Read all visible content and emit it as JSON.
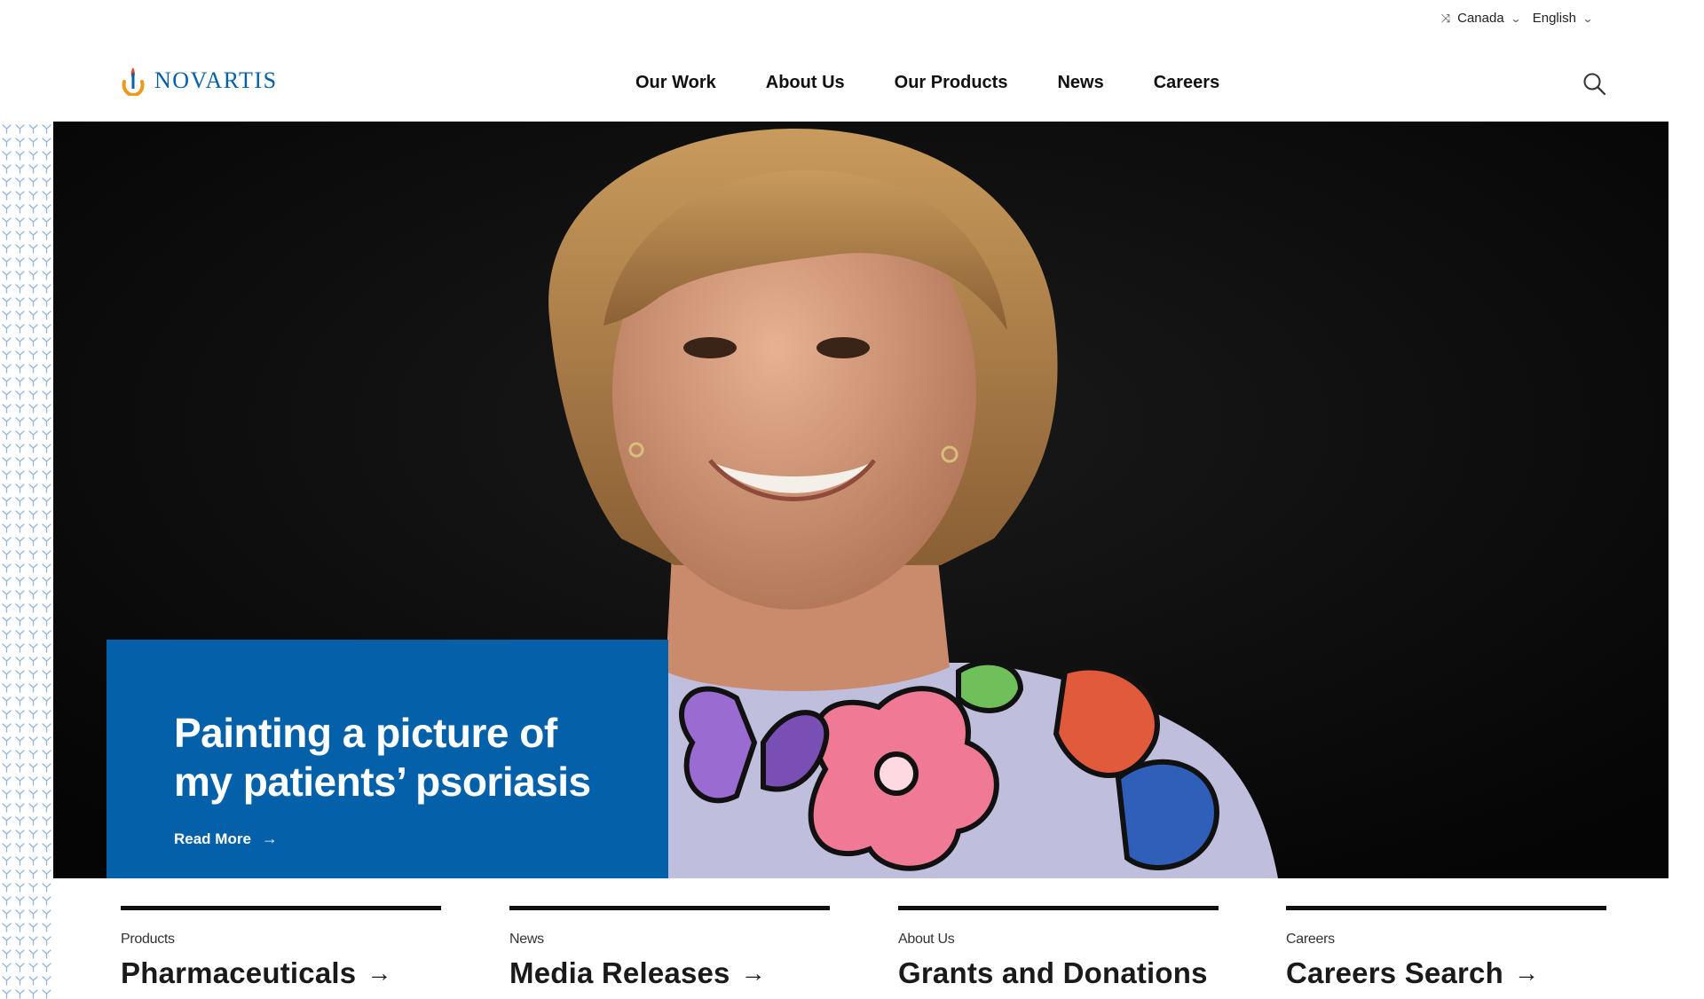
{
  "utility": {
    "country": "Canada",
    "language": "English",
    "country_icon": "switch-arrows-icon",
    "chevron_icon": "chevron-down-icon"
  },
  "header": {
    "logo_text": "NOVARTIS",
    "nav": [
      "Our Work",
      "About Us",
      "Our Products",
      "News",
      "Careers"
    ],
    "search_icon": "search-icon"
  },
  "hero": {
    "title_line1": "Painting a picture of",
    "title_line2": "my patients’ psoriasis",
    "link_label": "Read More",
    "link_arrow": "→",
    "slide_count": 4,
    "active_slide": 3
  },
  "cards": [
    {
      "category": "Products",
      "title": "Pharmaceuticals",
      "arrow": "→"
    },
    {
      "category": "News",
      "title": "Media Releases",
      "arrow": "→"
    },
    {
      "category": "About Us",
      "title": "Grants and Donations",
      "arrow": ""
    },
    {
      "category": "Careers",
      "title": "Careers Search",
      "arrow": "→"
    }
  ],
  "colors": {
    "brand_blue": "#0460a9",
    "logo_orange": "#ec9a1e",
    "logo_red": "#e74a21",
    "text_dark": "#111111",
    "pattern_blue": "#8fb6e0"
  }
}
